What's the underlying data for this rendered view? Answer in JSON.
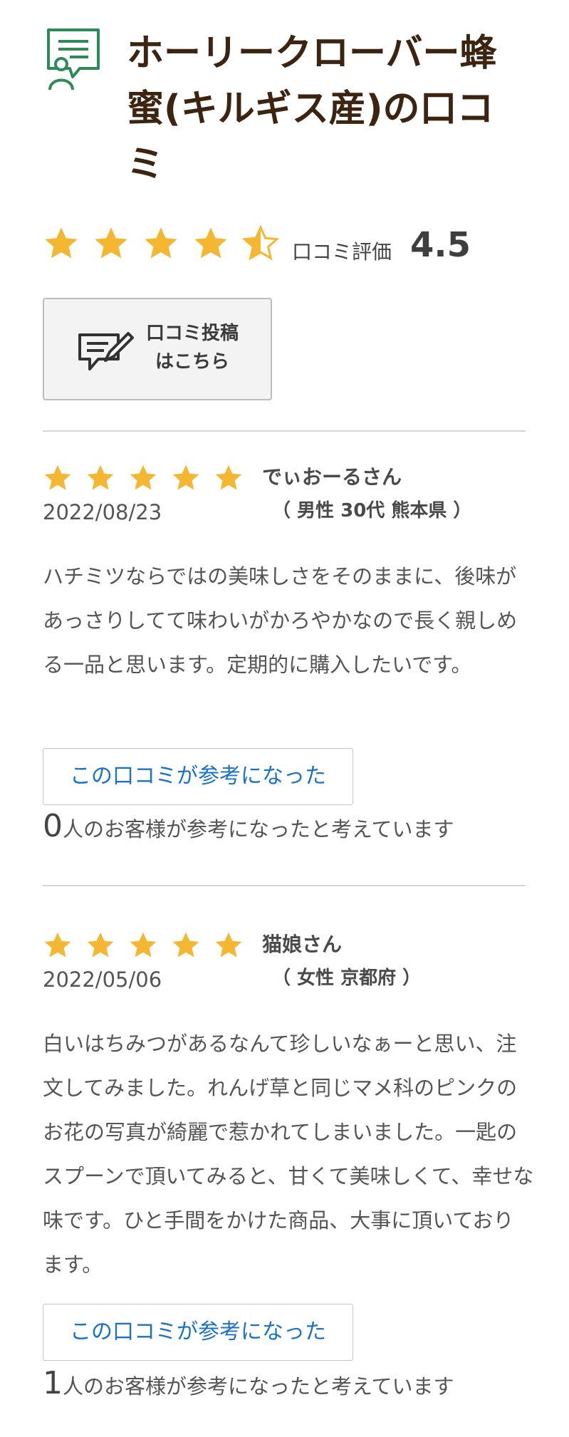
{
  "header": {
    "title": "ホーリークローバー蜂蜜(キルギス産)の口コミ",
    "icon": "review-chat-person-icon",
    "icon_color": "#2e8b57",
    "title_color": "#3d2410"
  },
  "summary": {
    "stars": 4.5,
    "star_color": "#f5b731",
    "label": "口コミ評価",
    "value": "4.5"
  },
  "post_button": {
    "icon": "edit-chat-icon",
    "label_line1": "口コミ投稿",
    "label_line2": "はこちら"
  },
  "reviews": [
    {
      "stars": 5,
      "reviewer": "でぃおーるさん",
      "meta": "（ 男性 30代 熊本県 ）",
      "date": "2022/08/23",
      "body": "ハチミツならではの美味しさをそのままに、後味があっさりしてて味わいがかろやかなので長く親しめる一品と思います。定期的に購入したいです。",
      "helpful_button": "この口コミが参考になった",
      "helpful_num": "0",
      "helpful_suffix": "人のお客様が参考になったと考えています"
    },
    {
      "stars": 5,
      "reviewer": "猫娘さん",
      "meta": "（ 女性 京都府 ）",
      "date": "2022/05/06",
      "body": "白いはちみつがあるなんて珍しいなぁーと思い、注文してみました。れんげ草と同じマメ科のピンクのお花の写真が綺麗で惹かれてしまいました。一匙のスプーンで頂いてみると、甘くて美味しくて、幸せな味です。ひと手間をかけた商品、大事に頂いております。",
      "helpful_button": "この口コミが参考になった",
      "helpful_num": "1",
      "helpful_suffix": "人のお客様が参考になったと考えています"
    }
  ]
}
